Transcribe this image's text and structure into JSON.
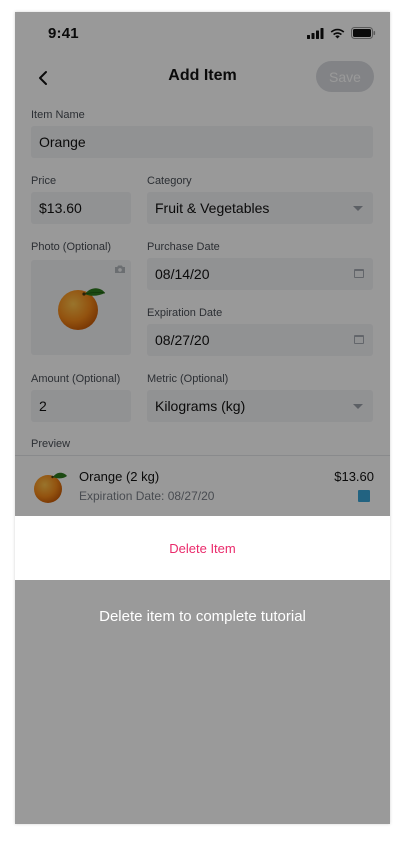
{
  "status_bar": {
    "time": "9:41"
  },
  "nav": {
    "title": "Add Item",
    "save_label": "Save"
  },
  "form": {
    "item_name": {
      "label": "Item Name",
      "value": "Orange"
    },
    "price": {
      "label": "Price",
      "value": "$13.60"
    },
    "category": {
      "label": "Category",
      "value": "Fruit & Vegetables"
    },
    "photo": {
      "label": "Photo (Optional)"
    },
    "purchase_date": {
      "label": "Purchase Date",
      "value": "08/14/20"
    },
    "expiration_date": {
      "label": "Expiration Date",
      "value": "08/27/20"
    },
    "amount": {
      "label": "Amount (Optional)",
      "value": "2"
    },
    "metric": {
      "label": "Metric (Optional)",
      "value": "Kilograms (kg)"
    }
  },
  "preview": {
    "label": "Preview",
    "name": "Orange (2 kg)",
    "expiration": "Expiration Date: 08/27/20",
    "price": "$13.60"
  },
  "sheet": {
    "delete_label": "Delete Item"
  },
  "tutorial": {
    "text": "Delete item to complete tutorial"
  },
  "colors": {
    "accent_delete": "#ea2a6b",
    "status_square": "#39a5d8",
    "overlay": "#9a9a9a"
  }
}
